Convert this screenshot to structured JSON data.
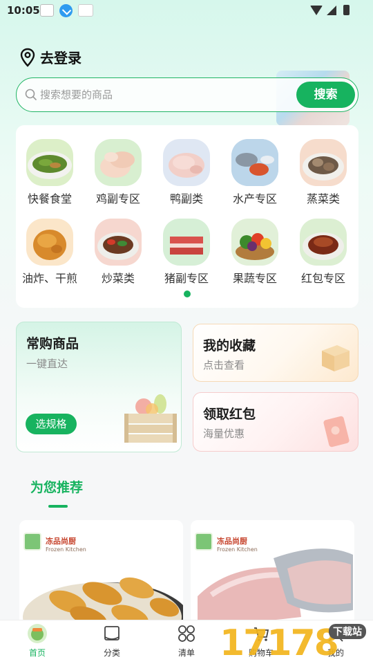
{
  "status_bar": {
    "time": "10:05"
  },
  "header": {
    "login_label": "去登录"
  },
  "search": {
    "placeholder": "搜索想要的商品",
    "button_label": "搜索"
  },
  "categories": [
    {
      "label": "快餐食堂",
      "icon": "fast-food-dish"
    },
    {
      "label": "鸡副专区",
      "icon": "chicken-parts"
    },
    {
      "label": "鸭副类",
      "icon": "duck-parts"
    },
    {
      "label": "水产专区",
      "icon": "seafood"
    },
    {
      "label": "蒸菜类",
      "icon": "steamed-dish"
    },
    {
      "label": "油炸、干煎",
      "icon": "fried-chicken"
    },
    {
      "label": "炒菜类",
      "icon": "stir-fry"
    },
    {
      "label": "猪副专区",
      "icon": "pork"
    },
    {
      "label": "果蔬专区",
      "icon": "vegetables"
    },
    {
      "label": "红包专区",
      "icon": "braised-pork"
    }
  ],
  "features": {
    "frequent": {
      "title": "常购商品",
      "subtitle": "一键直达",
      "button_label": "选规格"
    },
    "favorites": {
      "title": "我的收藏",
      "subtitle": "点击查看"
    },
    "coupon": {
      "title": "领取红包",
      "subtitle": "海量优惠"
    }
  },
  "recommend": {
    "title": "为您推荐"
  },
  "products": [
    {
      "brand": "冻品尚厨",
      "brand_sub": "Frozen Kitchen"
    },
    {
      "brand": "冻品尚厨",
      "brand_sub": "Frozen Kitchen"
    }
  ],
  "tabs": [
    {
      "label": "首页",
      "active": true
    },
    {
      "label": "分类",
      "active": false
    },
    {
      "label": "清单",
      "active": false
    },
    {
      "label": "购物车",
      "active": false
    },
    {
      "label": "我的",
      "active": false
    }
  ],
  "watermark": {
    "text": "17178",
    "sub": "下载站"
  },
  "colors": {
    "accent": "#17b35f",
    "text": "#222222"
  }
}
